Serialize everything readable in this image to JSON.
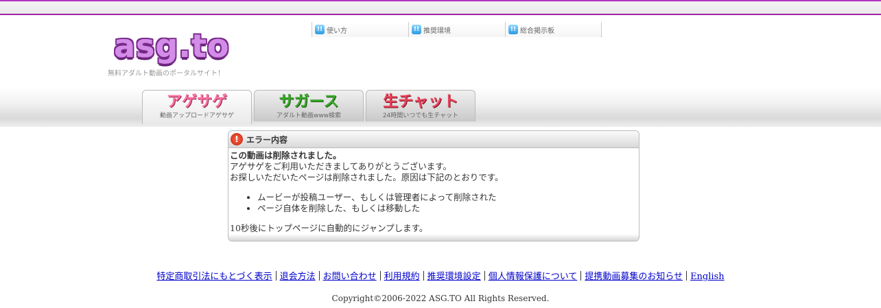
{
  "header": {
    "logo_text": "asg.to",
    "tagline": "無料アダルト動画のポータルサイト！"
  },
  "topnav": {
    "items": [
      {
        "label": "使い方",
        "icon": "info-icon"
      },
      {
        "label": "推奨環境",
        "icon": "info-icon"
      },
      {
        "label": "総合掲示板",
        "icon": "info-icon"
      }
    ]
  },
  "tabs": [
    {
      "logo": "アゲサゲ",
      "sub": "動画アップロードアゲサゲ"
    },
    {
      "logo": "サガース",
      "sub": "アダルト動画www検索"
    },
    {
      "logo": "生チャット",
      "sub": "24時間いつでも生チャット"
    }
  ],
  "error": {
    "title": "エラー内容",
    "heading": "この動画は削除されました。",
    "line1": "アゲサゲをご利用いただきましてありがとうございます。",
    "line2": "お探しいただいたページは削除されました。原因は下記のとおりです。",
    "reasons": [
      "ムービーが投稿ユーザー、もしくは管理者によって削除された",
      "ページ自体を削除した、もしくは移動した"
    ],
    "redirect_note": "10秒後にトップページに自動的にジャンプします。"
  },
  "footer": {
    "links": [
      "特定商取引法にもとづく表示",
      "退会方法",
      "お問い合わせ",
      "利用規約",
      "推奨環境設定",
      "個人情報保護について",
      "提携動画募集のお知らせ",
      "English"
    ],
    "copyright": "Copyright©2006-2022 ASG.TO All Rights Reserved."
  },
  "colors": {
    "accent": "#a020a8",
    "link": "#0000cc"
  }
}
